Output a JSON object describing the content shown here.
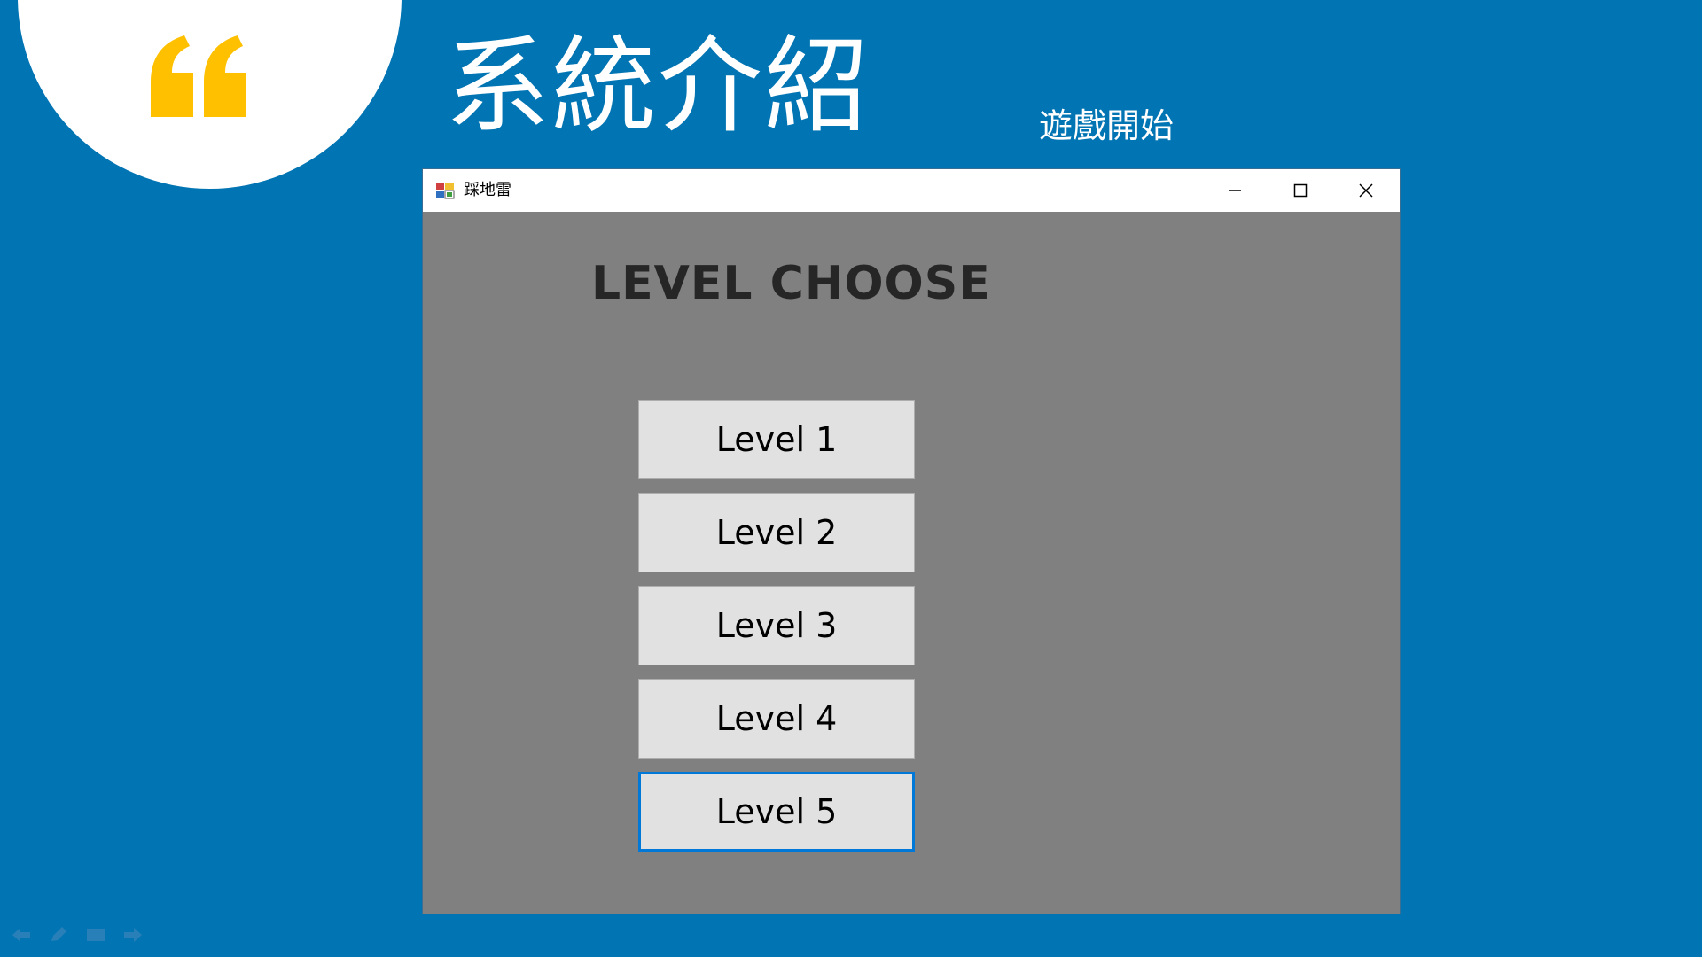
{
  "slide": {
    "title": "系統介紹",
    "subtitle": "遊戲開始",
    "quote_icon": "left-double-quote-icon",
    "quote_color": "#ffc000",
    "background_color": "#0174b3"
  },
  "window": {
    "title": "踩地雷",
    "app_icon": "minesweeper-app-icon",
    "controls": {
      "minimize_icon": "minimize-icon",
      "maximize_icon": "maximize-icon",
      "close_icon": "close-icon"
    },
    "client_background": "#808080"
  },
  "level_chooser": {
    "heading": "LEVEL CHOOSE",
    "buttons": [
      {
        "label": "Level 1",
        "focused": false
      },
      {
        "label": "Level 2",
        "focused": false
      },
      {
        "label": "Level 3",
        "focused": false
      },
      {
        "label": "Level 4",
        "focused": false
      },
      {
        "label": "Level 5",
        "focused": true
      }
    ],
    "focus_color": "#0078d7"
  },
  "slideshow_toolbar": {
    "icons": [
      "previous-arrow-icon",
      "pen-icon",
      "slide-menu-icon",
      "next-arrow-icon"
    ]
  }
}
